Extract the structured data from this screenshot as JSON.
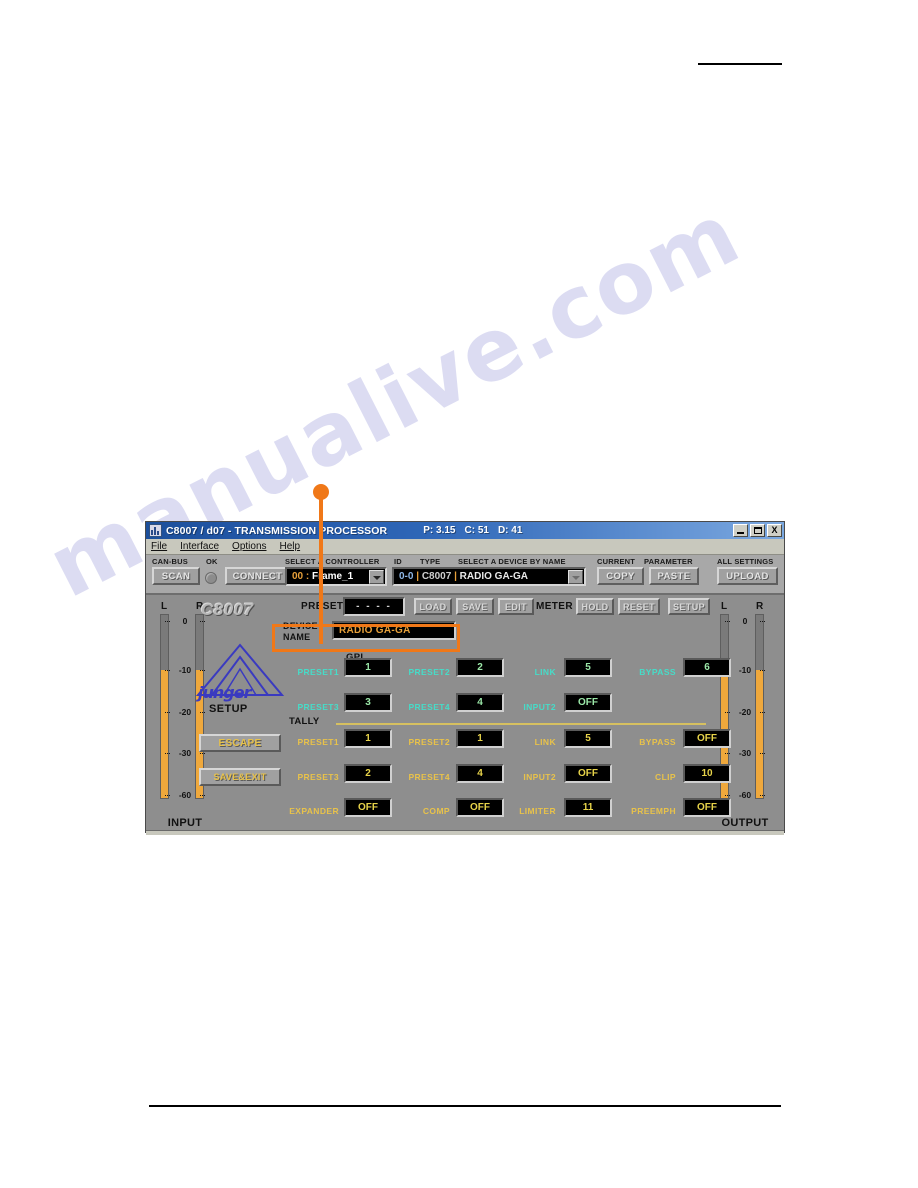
{
  "window": {
    "title": "C8007 / d07 - TRANSMISSION PROCESSOR",
    "stats": {
      "p": "P: 3.15",
      "c": "C: 51",
      "d": "D: 41"
    },
    "buttons": {
      "minimize": "_",
      "maximize": "□",
      "close": "X"
    }
  },
  "menubar": [
    {
      "label": "File"
    },
    {
      "label": "Interface"
    },
    {
      "label": "Options"
    },
    {
      "label": "Help"
    }
  ],
  "toolbar": {
    "canbus_label": "CAN-BUS",
    "ok_label": "OK",
    "scan_label": "SCAN",
    "connect_label": "CONNECT",
    "select_controller_label": "SELECT A CONTROLLER",
    "controller_id": "00 :",
    "controller_name": "Frame_1",
    "id_label": "ID",
    "type_label": "TYPE",
    "select_device_label": "SELECT A DEVICE BY NAME",
    "device_id": "0-0",
    "device_sep1": "|",
    "device_type": "C8007",
    "device_sep2": "|",
    "device_name": "RADIO GA-GA",
    "current_label": "CURRENT",
    "parameter_label": "PARAMETER",
    "copy_label": "COPY",
    "paste_label": "PASTE",
    "all_settings_label": "ALL SETTINGS",
    "upload_label": "UPLOAD"
  },
  "panel": {
    "brand": "C8007",
    "logo_word": "junger",
    "setup_label": "SETUP",
    "escape_label": "ESCAPE",
    "saveexit_label": "SAVE&EXIT",
    "preset_label": "PRESET",
    "preset_value": "- - - -",
    "load_label": "LOAD",
    "save_label": "SAVE",
    "edit_label": "EDIT",
    "device_name_label": "DEVICE NAME",
    "device_name_value": "RADIO GA-GA",
    "meter_label": "METER",
    "hold_label": "HOLD",
    "reset_label": "RESET",
    "setup_button_label": "SETUP",
    "gpi_title": "GPI",
    "tally_title": "TALLY",
    "gpi": [
      {
        "label": "PRESET1",
        "value": "1"
      },
      {
        "label": "PRESET2",
        "value": "2"
      },
      {
        "label": "LINK",
        "value": "5"
      },
      {
        "label": "BYPASS",
        "value": "6"
      },
      {
        "label": "PRESET3",
        "value": "3"
      },
      {
        "label": "PRESET4",
        "value": "4"
      },
      {
        "label": "INPUT2",
        "value": "OFF"
      }
    ],
    "tally": [
      {
        "label": "PRESET1",
        "value": "1"
      },
      {
        "label": "PRESET2",
        "value": "1"
      },
      {
        "label": "LINK",
        "value": "5"
      },
      {
        "label": "BYPASS",
        "value": "OFF"
      },
      {
        "label": "PRESET3",
        "value": "2"
      },
      {
        "label": "PRESET4",
        "value": "4"
      },
      {
        "label": "INPUT2",
        "value": "OFF"
      },
      {
        "label": "CLIP",
        "value": "10"
      },
      {
        "label": "EXPANDER",
        "value": "OFF"
      },
      {
        "label": "COMP",
        "value": "OFF"
      },
      {
        "label": "LIMITER",
        "value": "11"
      },
      {
        "label": "PREEMPH",
        "value": "OFF"
      }
    ]
  },
  "meters": {
    "scale": [
      "0",
      "-10",
      "-20",
      "-30",
      "-60"
    ],
    "input": {
      "caption": "INPUT",
      "left_label": "L",
      "right_label": "R"
    },
    "output": {
      "caption": "OUTPUT",
      "left_label": "L",
      "right_label": "R"
    }
  },
  "watermark": {
    "text": "manualive.com"
  }
}
